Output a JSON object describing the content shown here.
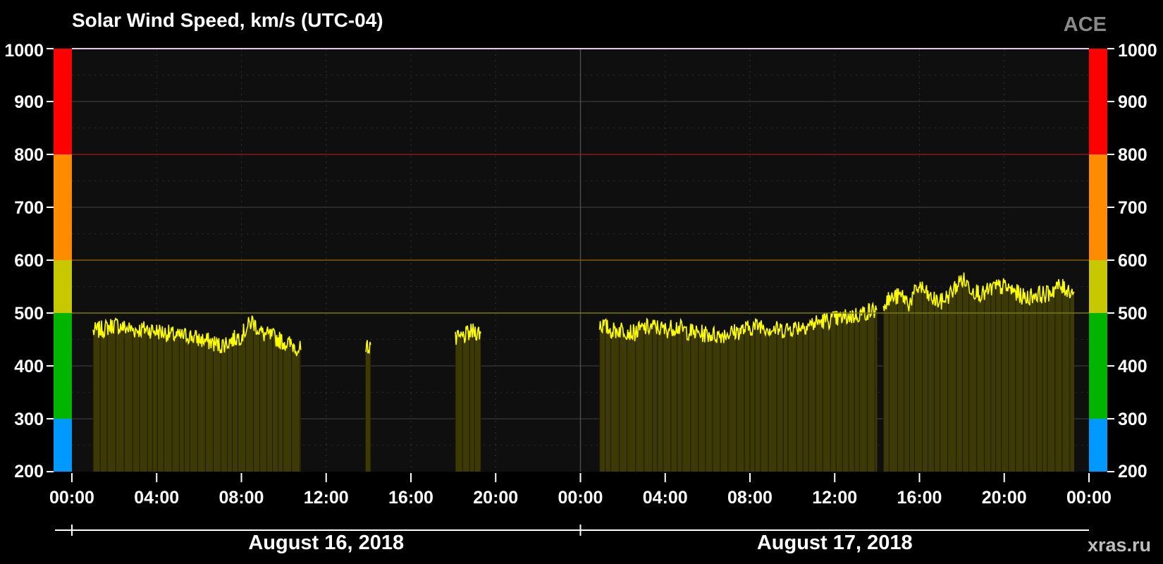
{
  "chart_data": {
    "type": "area",
    "title": "Solar Wind Speed, km/s (UTC-04)",
    "source_label": "ACE",
    "credit": "xras.ru",
    "ylim": [
      200,
      1000
    ],
    "yticks": [
      "200",
      "300",
      "400",
      "500",
      "600",
      "700",
      "800",
      "900",
      "1000"
    ],
    "x_range_hours": [
      0,
      48
    ],
    "xtick_labels": [
      "00:00",
      "04:00",
      "08:00",
      "12:00",
      "16:00",
      "20:00",
      "00:00",
      "04:00",
      "08:00",
      "12:00",
      "16:00",
      "20:00",
      "00:00"
    ],
    "date_labels": [
      "August 16, 2018",
      "August 17, 2018"
    ],
    "grid": true,
    "threshold_lines": [
      {
        "value": 500,
        "color": "#7a7a00"
      },
      {
        "value": 600,
        "color": "#8a5a00"
      },
      {
        "value": 800,
        "color": "#8a1a1a"
      }
    ],
    "scale_bands": [
      {
        "from": 200,
        "to": 300,
        "color": "#0099ff"
      },
      {
        "from": 300,
        "to": 500,
        "color": "#00b400"
      },
      {
        "from": 500,
        "to": 600,
        "color": "#c8c800"
      },
      {
        "from": 600,
        "to": 800,
        "color": "#ff8c00"
      },
      {
        "from": 800,
        "to": 1000,
        "color": "#ff0000"
      }
    ],
    "series_color": "#ffff00",
    "fill_color": "#3d3a05",
    "series": [
      {
        "segment": 1,
        "x": [
          1.0,
          1.5,
          2.0,
          2.5,
          3.0,
          3.5,
          4.0,
          4.5,
          5.0,
          5.5,
          6.0,
          6.5,
          7.0,
          7.5,
          8.0,
          8.5,
          9.0,
          9.5,
          10.0,
          10.5,
          10.8
        ],
        "y": [
          465,
          470,
          478,
          472,
          468,
          470,
          466,
          462,
          455,
          458,
          450,
          446,
          438,
          448,
          458,
          485,
          460,
          455,
          445,
          438,
          430
        ]
      },
      {
        "segment": 2,
        "x": [
          13.85,
          14.0,
          14.1
        ],
        "y": [
          432,
          438,
          440
        ]
      },
      {
        "segment": 3,
        "x": [
          18.1,
          18.5,
          19.0,
          19.3
        ],
        "y": [
          448,
          456,
          466,
          462
        ]
      },
      {
        "segment": 4,
        "x": [
          24.9,
          25.5,
          26.0,
          26.5,
          27.0,
          27.5,
          28.0,
          28.5,
          29.0,
          29.5,
          30.0,
          30.5,
          31.0,
          31.5,
          32.0,
          32.5,
          33.0,
          33.5,
          34.0,
          34.5,
          35.0,
          35.5,
          36.0,
          36.5,
          37.0,
          37.5,
          38.0
        ],
        "y": [
          480,
          466,
          470,
          462,
          472,
          474,
          468,
          475,
          466,
          462,
          460,
          458,
          462,
          466,
          472,
          478,
          470,
          468,
          472,
          476,
          480,
          486,
          488,
          492,
          496,
          502,
          506
        ]
      },
      {
        "segment": 5,
        "x": [
          38.3,
          38.8,
          39.2,
          39.5,
          40.0,
          40.5,
          41.0,
          41.5,
          42.0,
          42.5,
          43.0,
          43.5,
          44.0,
          44.5,
          45.0,
          45.5,
          46.0,
          46.5,
          47.0,
          47.3
        ],
        "y": [
          520,
          530,
          532,
          518,
          552,
          528,
          520,
          538,
          565,
          545,
          535,
          548,
          550,
          540,
          528,
          536,
          535,
          550,
          545,
          540
        ]
      }
    ]
  }
}
